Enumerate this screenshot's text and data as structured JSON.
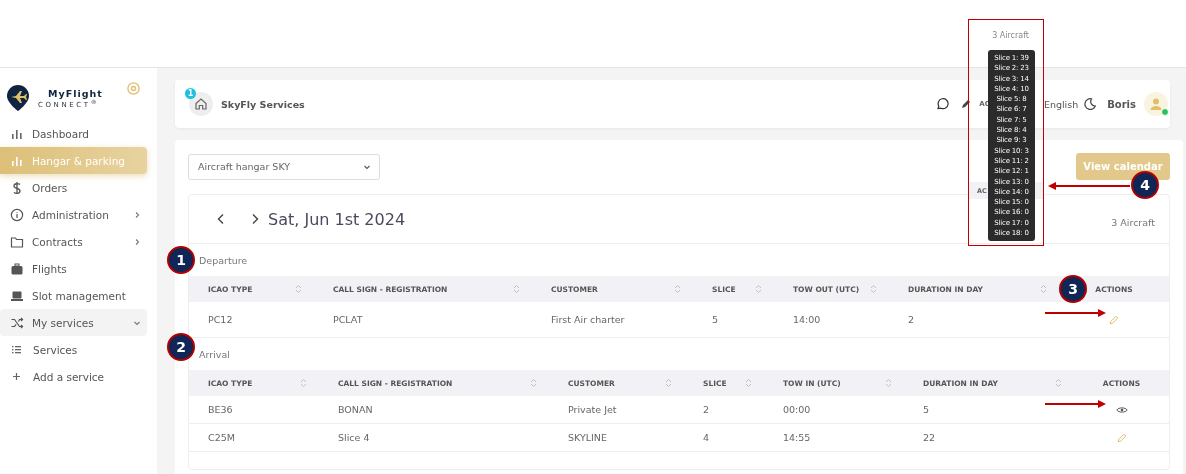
{
  "sidebar": {
    "logo": {
      "title": "MyFlight",
      "subtitle": "CONNECT$^{®}$"
    },
    "items": [
      {
        "label": "Dashboard",
        "selected": false
      },
      {
        "label": "Hangar & parking",
        "selected": true
      },
      {
        "label": "Orders",
        "selected": false
      },
      {
        "label": "Administration",
        "selected": false,
        "expanded": false
      },
      {
        "label": "Contracts",
        "selected": false,
        "expanded": false
      },
      {
        "label": "Flights",
        "selected": false
      },
      {
        "label": "Slot management",
        "selected": false
      },
      {
        "label": "My services",
        "selected": false,
        "expanded": true,
        "children": [
          {
            "label": "Services",
            "selected": false
          },
          {
            "label": "Add a service",
            "selected": false
          }
        ]
      }
    ]
  },
  "header": {
    "organization": "SkyFly Services",
    "badge": "1",
    "cut_label": "AC",
    "language": "English",
    "user": "Boris"
  },
  "toolbar": {
    "hangar_select": "Aircraft hangar SKY",
    "button": "View calendar"
  },
  "day": {
    "date": "Sat, Jun 1st 2024",
    "count": "3 Aircraft"
  },
  "sections": [
    {
      "title": "Departure",
      "columns": [
        "ICAO TYPE",
        "CALL SIGN - REGISTRATION",
        "CUSTOMER",
        "SLICE",
        "TOW OUT (UTC)",
        "DURATION IN DAY",
        "ACTIONS"
      ],
      "rows": [
        {
          "cells": [
            "PC12",
            "PCLAT",
            "First Air charter",
            "5",
            "14:00",
            "2"
          ],
          "kind": "edit"
        }
      ]
    },
    {
      "title": "Arrival",
      "columns": [
        "ICAO TYPE",
        "CALL SIGN - REGISTRATION",
        "CUSTOMER",
        "SLICE",
        "TOW IN (UTC)",
        "DURATION IN DAY",
        "ACTIONS"
      ],
      "rows": [
        {
          "cells": [
            "BE36",
            "BONAN",
            "Private Jet",
            "2",
            "00:00",
            "5"
          ],
          "kind": "view"
        },
        {
          "cells": [
            "C25M",
            "Slice 4",
            "SKYLINE",
            "4",
            "14:55",
            "22"
          ],
          "kind": "edit"
        }
      ]
    }
  ],
  "annotation": {
    "count": "3 Aircraft",
    "cut_label": "AC",
    "tooltip": [
      "Slice 1: 39",
      "Slice 2: 23",
      "Slice 3: 14",
      "Slice 4: 10",
      "Slice 5: 8",
      "Slice 6: 7",
      "Slice 7: 5",
      "Slice 8: 4",
      "Slice 9: 3",
      "Slice 10: 3",
      "Slice 11: 2",
      "Slice 12: 1",
      "Slice 13: 0",
      "Slice 14: 0",
      "Slice 15: 0",
      "Slice 16: 0",
      "Slice 17: 0",
      "Slice 18: 0"
    ],
    "callouts": [
      "1",
      "2",
      "3",
      "4"
    ]
  }
}
